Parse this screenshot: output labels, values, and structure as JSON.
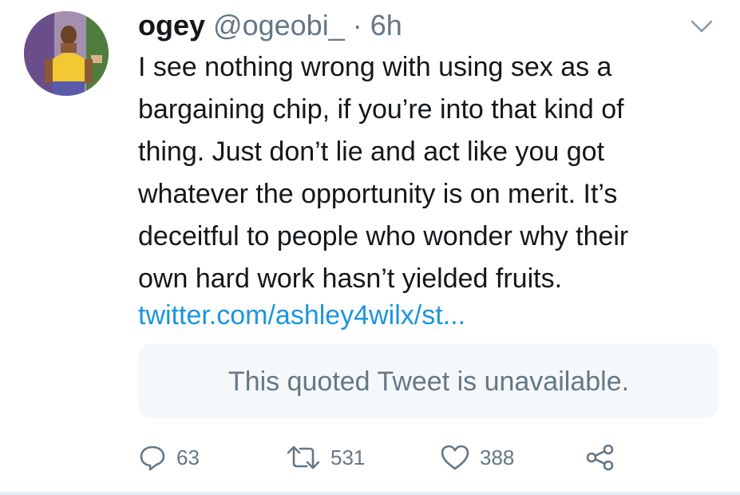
{
  "tweet": {
    "author": {
      "name": "ogey",
      "handle": "@ogeobi_",
      "separator": "·",
      "time": "6h"
    },
    "text": "I see nothing wrong with using sex as a\nbargaining chip, if you’re into that kind of\nthing. Just don’t lie and act like you got\nwhatever the opportunity is on merit. It’s\ndeceitful to people who wonder why their\nown hard work hasn’t yielded fruits.",
    "link": "twitter.com/ashley4wilx/st...",
    "quote": {
      "text": "This quoted Tweet is unavailable."
    },
    "actions": {
      "replies": "63",
      "retweets": "531",
      "likes": "388"
    },
    "icons": {
      "reply": "reply-icon",
      "retweet": "retweet-icon",
      "like": "heart-icon",
      "share": "share-icon",
      "menu": "chevron-down-icon"
    },
    "colors": {
      "text": "#14171a",
      "muted": "#657786",
      "link": "#1b95e0",
      "quote_bg": "#f5f8fa"
    }
  }
}
